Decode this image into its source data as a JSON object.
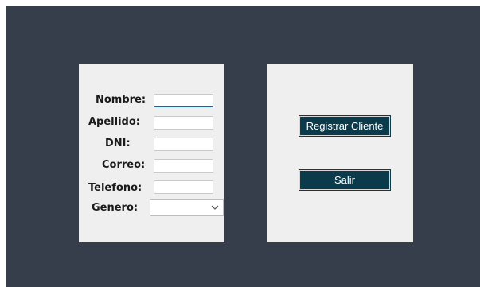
{
  "form": {
    "labels": {
      "nombre": "Nombre:",
      "apellido": "Apellido:",
      "dni": "DNI:",
      "correo": "Correo:",
      "telefono": "Telefono:",
      "genero": "Genero:"
    },
    "values": {
      "nombre": "",
      "apellido": "",
      "dni": "",
      "correo": "",
      "telefono": "",
      "genero": ""
    }
  },
  "actions": {
    "register_label": "Registrar Cliente",
    "exit_label": "Salir"
  },
  "colors": {
    "window_bg": "#363e4c",
    "panel_bg": "#efefef",
    "button_bg": "#0b3a4a",
    "focus_accent": "#0a64c8"
  },
  "icons": {
    "combo_arrow": "chevron-down-icon"
  }
}
